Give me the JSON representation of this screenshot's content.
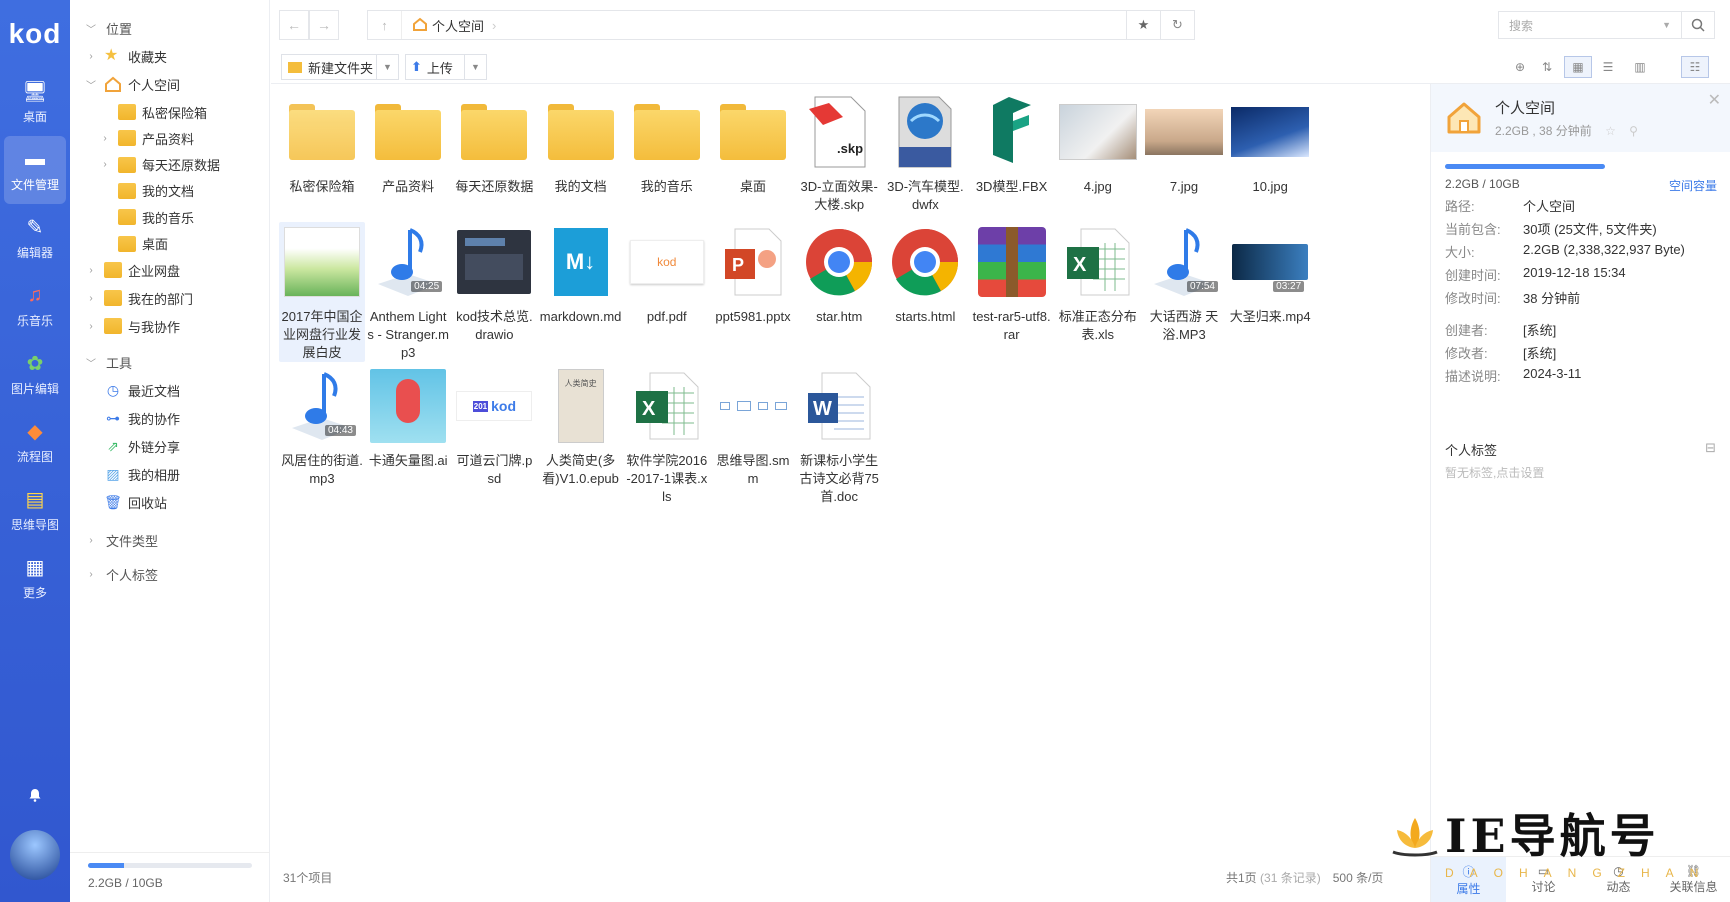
{
  "nav": {
    "logo": "kod",
    "items": [
      {
        "label": "桌面",
        "icon": "desktop-icon"
      },
      {
        "label": "文件管理",
        "icon": "folder-icon",
        "active": true
      },
      {
        "label": "编辑器",
        "icon": "editor-icon"
      },
      {
        "label": "乐音乐",
        "icon": "music-icon"
      },
      {
        "label": "图片编辑",
        "icon": "image-edit-icon"
      },
      {
        "label": "流程图",
        "icon": "flowchart-icon"
      },
      {
        "label": "思维导图",
        "icon": "mindmap-icon"
      },
      {
        "label": "更多",
        "icon": "grid-icon"
      }
    ]
  },
  "tree": {
    "location": "位置",
    "favorites": "收藏夹",
    "personal": "个人空间",
    "children": [
      "私密保险箱",
      "产品资料",
      "每天还原数据",
      "我的文档",
      "我的音乐",
      "桌面"
    ],
    "enterprise": "企业网盘",
    "dept": "我在的部门",
    "collab": "与我协作",
    "tools": "工具",
    "toolItems": [
      "最近文档",
      "我的协作",
      "外链分享",
      "我的相册",
      "回收站"
    ],
    "fileTypes": "文件类型",
    "tags": "个人标签",
    "quota": "2.2GB / 10GB",
    "quotaFraction": 0.22
  },
  "address": {
    "crumb": "个人空间",
    "searchPlaceholder": "搜索"
  },
  "toolbar": {
    "newFolder": "新建文件夹",
    "upload": "上传"
  },
  "files": [
    {
      "name": "私密保险箱",
      "type": "vault"
    },
    {
      "name": "产品资料",
      "type": "folder"
    },
    {
      "name": "每天还原数据",
      "type": "folder"
    },
    {
      "name": "我的文档",
      "type": "folder"
    },
    {
      "name": "我的音乐",
      "type": "folder"
    },
    {
      "name": "桌面",
      "type": "folder"
    },
    {
      "name": "3D-立面效果-大楼.skp",
      "type": "skp",
      "badge": ".skp"
    },
    {
      "name": "3D-汽车模型.dwfx",
      "type": "dwfx",
      "badge": "DWF"
    },
    {
      "name": "3D模型.FBX",
      "type": "fbx"
    },
    {
      "name": "4.jpg",
      "type": "img1"
    },
    {
      "name": "7.jpg",
      "type": "img2"
    },
    {
      "name": "10.jpg",
      "type": "img3"
    },
    {
      "name": "2017年中国企业网盘行业发展白皮",
      "type": "pdfthumb"
    },
    {
      "name": "Anthem Lights - Stranger.mp3",
      "type": "mp3",
      "dur": "04:25"
    },
    {
      "name": "kod技术总览.drawio",
      "type": "drawio"
    },
    {
      "name": "markdown.md",
      "type": "md"
    },
    {
      "name": "pdf.pdf",
      "type": "pdf",
      "badge": "kod"
    },
    {
      "name": "ppt5981.pptx",
      "type": "ppt"
    },
    {
      "name": "star.htm",
      "type": "chrome"
    },
    {
      "name": "starts.html",
      "type": "chrome"
    },
    {
      "name": "test-rar5-utf8.rar",
      "type": "rar"
    },
    {
      "name": "标准正态分布表.xls",
      "type": "xls"
    },
    {
      "name": "大话西游 天浴.MP3",
      "type": "mp3",
      "dur": "07:54"
    },
    {
      "name": "大圣归来.mp4",
      "type": "mp4",
      "dur": "03:27"
    },
    {
      "name": "风居住的街道.mp3",
      "type": "mp3",
      "dur": "04:43"
    },
    {
      "name": "卡通矢量图.ai",
      "type": "ai"
    },
    {
      "name": "可道云门牌.psd",
      "type": "psd",
      "badge": "kod"
    },
    {
      "name": "人类简史(多看)V1.0.epub",
      "type": "epub",
      "badge": "人类简史"
    },
    {
      "name": "软件学院2016-2017-1课表.xls",
      "type": "xls"
    },
    {
      "name": "思维导图.smm",
      "type": "smm"
    },
    {
      "name": "新课标小学生古诗文必背75首.doc",
      "type": "doc"
    }
  ],
  "status": {
    "count": "31个项目",
    "pages": "共1页",
    "records": "(31 条记录)",
    "perPage": "500 条/页"
  },
  "panel": {
    "title": "个人空间",
    "subtitle": "2.2GB , 38 分钟前",
    "quota": "2.2GB / 10GB",
    "quotaLink": "空间容量",
    "quotaFraction": 0.22,
    "props": [
      {
        "k": "路径:",
        "v": "个人空间"
      },
      {
        "k": "当前包含:",
        "v": "30项 (25文件, 5文件夹)"
      },
      {
        "k": "大小:",
        "v": "2.2GB (2,338,322,937 Byte)"
      },
      {
        "k": "创建时间:",
        "v": "2019-12-18 15:34"
      },
      {
        "k": "修改时间:",
        "v": "38 分钟前"
      },
      {
        "k": "创建者:",
        "v": "[系统]"
      },
      {
        "k": "修改者:",
        "v": "[系统]"
      },
      {
        "k": "描述说明:",
        "v": "2024-3-11"
      }
    ],
    "tagsTitle": "个人标签",
    "tagsHint": "暂无标签,点击设置",
    "tabs": [
      "属性",
      "讨论",
      "动态",
      "关联信息"
    ]
  },
  "watermark": "IE导航号",
  "watermarkSub": "DAOHANGZHAN"
}
